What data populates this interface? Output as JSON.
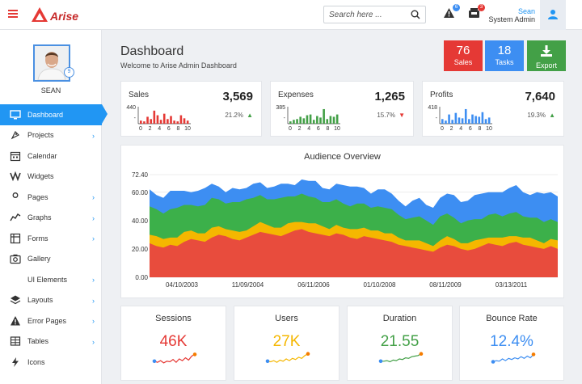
{
  "app": {
    "name": "Arise",
    "menu_icon": "hamburger-icon"
  },
  "search": {
    "placeholder": "Search here ..."
  },
  "topbar": {
    "alerts_badge": "6",
    "inbox_badge": "3",
    "user_name": "Sean",
    "user_role": "System Admin"
  },
  "profile": {
    "name": "SEAN",
    "badge": "9"
  },
  "sidebar": {
    "items": [
      {
        "label": "Dashboard",
        "icon": "monitor-icon",
        "active": true,
        "arrow": true
      },
      {
        "label": "Projects",
        "icon": "rocket-icon",
        "arrow": true
      },
      {
        "label": "Calendar",
        "icon": "calendar-icon",
        "arrow": false
      },
      {
        "label": "Widgets",
        "icon": "widgets-icon",
        "arrow": false
      },
      {
        "label": "Pages",
        "icon": "user-icon",
        "arrow": true
      },
      {
        "label": "Graphs",
        "icon": "graph-icon",
        "arrow": true
      },
      {
        "label": "Forms",
        "icon": "form-icon",
        "arrow": true
      },
      {
        "label": "Gallery",
        "icon": "camera-icon",
        "arrow": false
      },
      {
        "label": "UI Elements",
        "icon": "drop-icon",
        "arrow": true
      },
      {
        "label": "Layouts",
        "icon": "layers-icon",
        "arrow": true
      },
      {
        "label": "Error Pages",
        "icon": "warning-icon",
        "arrow": true
      },
      {
        "label": "Tables",
        "icon": "table-icon",
        "arrow": true
      },
      {
        "label": "Icons",
        "icon": "bolt-icon",
        "arrow": false
      }
    ],
    "arrow_glyph": "›"
  },
  "header": {
    "title": "Dashboard",
    "subtitle": "Welcome to Arise Admin Dashboard",
    "tiles": [
      {
        "value": "76",
        "label": "Sales",
        "color": "#e53935"
      },
      {
        "value": "18",
        "label": "Tasks",
        "color": "#3d8ef2"
      },
      {
        "value": "",
        "label": "Export",
        "color": "#43a047"
      }
    ]
  },
  "kpis": [
    {
      "title": "Sales",
      "value": "3,569",
      "pct": "21.2%",
      "trend": "up",
      "trend_glyph": "▲",
      "trend_color": "#43a047",
      "color": "#e53935",
      "ymax": "440",
      "bars": [
        0.2,
        0.15,
        0.45,
        0.3,
        0.85,
        0.55,
        0.25,
        0.65,
        0.3,
        0.5,
        0.2,
        0.15,
        0.55,
        0.35,
        0.2
      ]
    },
    {
      "title": "Expenses",
      "value": "1,265",
      "pct": "15.7%",
      "trend": "down",
      "trend_glyph": "▼",
      "trend_color": "#e53935",
      "color": "#43a047",
      "ymax": "385",
      "bars": [
        0.15,
        0.25,
        0.3,
        0.45,
        0.35,
        0.55,
        0.6,
        0.25,
        0.5,
        0.4,
        0.95,
        0.3,
        0.5,
        0.45,
        0.6
      ]
    },
    {
      "title": "Profits",
      "value": "7,640",
      "pct": "19.3%",
      "trend": "up",
      "trend_glyph": "▲",
      "trend_color": "#43a047",
      "color": "#3d8ef2",
      "ymax": "418",
      "bars": [
        0.3,
        0.2,
        0.6,
        0.25,
        0.7,
        0.4,
        0.35,
        0.95,
        0.3,
        0.6,
        0.5,
        0.45,
        0.75,
        0.3,
        0.4
      ]
    }
  ],
  "kpi_xticks": [
    "0",
    "2",
    "4",
    "6",
    "8",
    "10"
  ],
  "chart_data": {
    "type": "area",
    "title": "Audience Overview",
    "stacked": true,
    "ylim": [
      0,
      72.4
    ],
    "yticks": [
      "0.00",
      "20.00",
      "40.00",
      "60.00",
      "72.40"
    ],
    "xticks": [
      "04/10/2003",
      "11/09/2004",
      "06/11/2006",
      "01/10/2008",
      "08/11/2009",
      "03/13/2011"
    ],
    "series": [
      {
        "name": "",
        "color": "#e84c3d",
        "values": [
          24,
          22,
          21,
          23,
          22,
          25,
          27,
          26,
          25,
          28,
          30,
          29,
          27,
          26,
          28,
          30,
          32,
          31,
          30,
          29,
          31,
          33,
          34,
          32,
          31,
          30,
          29,
          31,
          30,
          28,
          27,
          29,
          28,
          27,
          26,
          25,
          23,
          22,
          21,
          20,
          19,
          18,
          21,
          23,
          22,
          20,
          19,
          20,
          22,
          24,
          23,
          22,
          24,
          25,
          23,
          22,
          21,
          20,
          22,
          20
        ]
      },
      {
        "name": "",
        "color": "#f5b700",
        "values": [
          6,
          7,
          6,
          5,
          6,
          7,
          6,
          5,
          6,
          7,
          6,
          5,
          6,
          6,
          5,
          6,
          7,
          6,
          5,
          6,
          7,
          6,
          5,
          6,
          7,
          6,
          5,
          6,
          5,
          6,
          7,
          6,
          5,
          6,
          5,
          6,
          5,
          4,
          5,
          6,
          5,
          4,
          5,
          6,
          5,
          4,
          5,
          6,
          5,
          4,
          5,
          6,
          5,
          4,
          5,
          6,
          5,
          4,
          5,
          6
        ]
      },
      {
        "name": "",
        "color": "#3cb04a",
        "values": [
          20,
          19,
          18,
          20,
          21,
          19,
          18,
          19,
          20,
          21,
          19,
          18,
          20,
          21,
          22,
          20,
          19,
          18,
          20,
          21,
          19,
          18,
          20,
          19,
          18,
          17,
          19,
          18,
          17,
          16,
          18,
          17,
          16,
          17,
          18,
          17,
          16,
          15,
          16,
          17,
          16,
          15,
          17,
          16,
          15,
          14,
          16,
          15,
          14,
          16,
          17,
          15,
          16,
          17,
          15,
          14,
          16,
          15,
          14,
          13
        ]
      },
      {
        "name": "",
        "color": "#3d8ef2",
        "values": [
          12,
          10,
          11,
          13,
          12,
          10,
          9,
          11,
          12,
          10,
          9,
          8,
          10,
          9,
          8,
          10,
          9,
          8,
          9,
          10,
          9,
          8,
          10,
          11,
          12,
          10,
          9,
          11,
          13,
          14,
          12,
          11,
          10,
          12,
          13,
          11,
          10,
          9,
          12,
          13,
          11,
          12,
          13,
          14,
          16,
          15,
          14,
          17,
          18,
          16,
          15,
          17,
          18,
          19,
          17,
          16,
          18,
          20,
          19,
          18
        ]
      }
    ]
  },
  "minis": [
    {
      "title": "Sessions",
      "value": "46K",
      "color": "#e53935",
      "dot": "#f57c00",
      "spark": [
        0.3,
        0.2,
        0.35,
        0.15,
        0.3,
        0.25,
        0.45,
        0.2,
        0.5,
        0.35,
        0.6,
        0.4,
        0.75,
        0.9
      ]
    },
    {
      "title": "Users",
      "value": "27K",
      "color": "#f5b700",
      "dot": "#f57c00",
      "spark": [
        0.3,
        0.25,
        0.35,
        0.2,
        0.4,
        0.3,
        0.5,
        0.35,
        0.55,
        0.45,
        0.65,
        0.55,
        0.8,
        0.95
      ]
    },
    {
      "title": "Duration",
      "value": "21.55",
      "color": "#43a047",
      "dot": "#f57c00",
      "spark": [
        0.3,
        0.3,
        0.35,
        0.25,
        0.4,
        0.35,
        0.5,
        0.45,
        0.6,
        0.55,
        0.7,
        0.75,
        0.8,
        0.95
      ]
    },
    {
      "title": "Bounce Rate",
      "value": "12.4%",
      "color": "#3d8ef2",
      "dot": "#f57c00",
      "spark": [
        0.25,
        0.35,
        0.3,
        0.5,
        0.35,
        0.55,
        0.45,
        0.6,
        0.5,
        0.7,
        0.55,
        0.75,
        0.6,
        0.9
      ]
    }
  ]
}
